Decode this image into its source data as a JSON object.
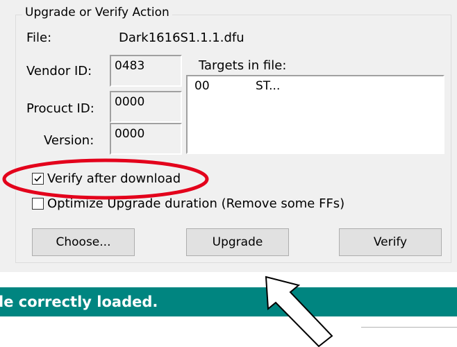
{
  "group": {
    "title": "Upgrade or Verify Action"
  },
  "file": {
    "label": "File:",
    "value": "Dark1616S1.1.1.dfu"
  },
  "vendor": {
    "label": "Vendor ID:",
    "value": "0483"
  },
  "product": {
    "label": "Procuct ID:",
    "value": "0000"
  },
  "version": {
    "label": "Version:",
    "value": "0000"
  },
  "targets": {
    "label": "Targets in file:",
    "rows": [
      {
        "id": "00",
        "name": "ST..."
      }
    ]
  },
  "options": {
    "verify_label": "Verify after download",
    "verify_checked": true,
    "optimize_label": "Optimize Upgrade duration (Remove some FFs)",
    "optimize_checked": false
  },
  "buttons": {
    "choose": "Choose...",
    "upgrade": "Upgrade",
    "verify": "Verify"
  },
  "status": {
    "text": "le correctly loaded."
  },
  "annotation": {
    "ellipse_color": "#e3001b",
    "arrow_color": "#000000"
  }
}
